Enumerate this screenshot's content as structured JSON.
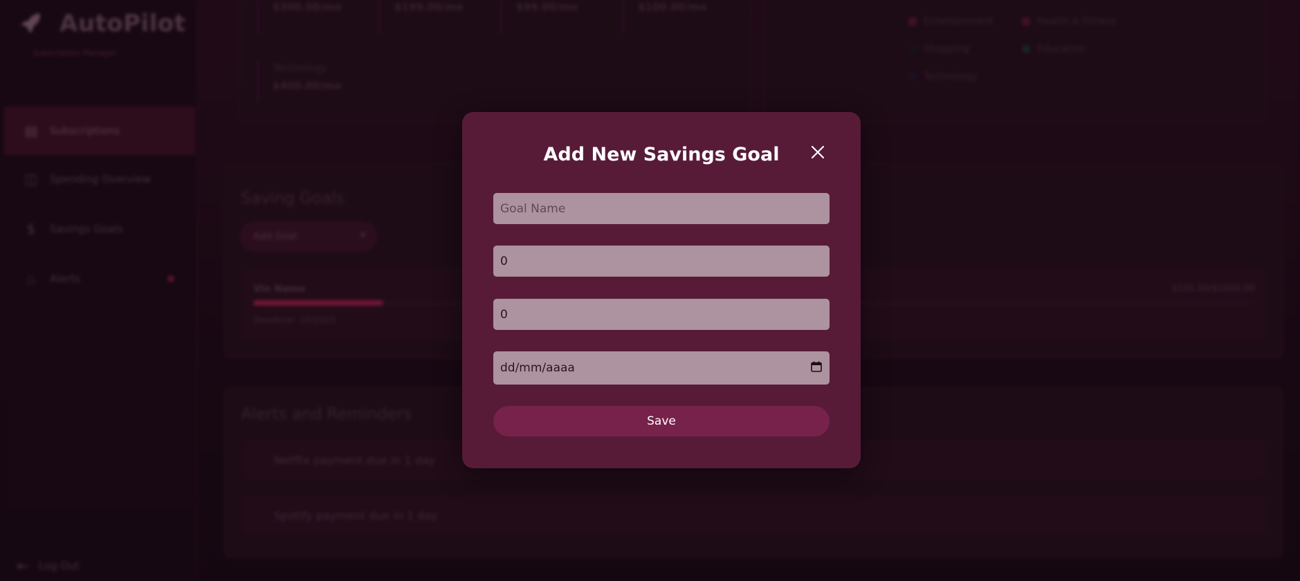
{
  "app": {
    "brand_name": "AutoPilot",
    "brand_tagline": "Subscription Manager",
    "brand_icon": "rocket-icon"
  },
  "sidebar": {
    "items": [
      {
        "label": "Subscriptions",
        "icon": "calendar-icon",
        "active": true
      },
      {
        "label": "Spending Overview",
        "icon": "chart-icon",
        "active": false
      },
      {
        "label": "Savings Goals",
        "icon": "dollar-icon",
        "active": false
      },
      {
        "label": "Alerts",
        "icon": "bell-icon",
        "active": false
      }
    ],
    "logout_label": "Log Out"
  },
  "subscriptions": {
    "cards": [
      {
        "amount": "$300.00/mo"
      },
      {
        "amount": "$199.00/mo"
      },
      {
        "amount": "$99.00/mo"
      },
      {
        "amount": "$100.00/mo"
      },
      {
        "category": "Technology",
        "amount": "$400.00/mo"
      }
    ],
    "legend": [
      {
        "label": "Entertainment",
        "color": "#5a1a30"
      },
      {
        "label": "Health & Fitness",
        "color": "#5a1a30"
      },
      {
        "label": "Shopping",
        "color": "#1a1a24"
      },
      {
        "label": "Education",
        "color": "#203030"
      },
      {
        "label": "Technology",
        "color": "#221a2c"
      }
    ]
  },
  "savings": {
    "title": "Saving Goals",
    "add_goal_label": "Add Goal",
    "goals": [
      {
        "name": "Vin Name",
        "amount": "$101.00/$1000.00",
        "progress": 0.13,
        "deadline": "Deadline: 10/2025"
      }
    ]
  },
  "alerts": {
    "title": "Alerts and Reminders",
    "items": [
      {
        "text": "Netflix payment due in 1 day"
      },
      {
        "text": "Spotify payment due in 1 day"
      }
    ]
  },
  "modal": {
    "title": "Add New Savings Goal",
    "close_icon": "close-icon",
    "goal_name_placeholder": "Goal Name",
    "target_value": "0",
    "current_value": "0",
    "date_placeholder": "dd/mm/aaaa",
    "date_icon": "calendar-icon",
    "save_label": "Save"
  },
  "colors": {
    "modal_bg": "#571b38",
    "input_bg": "#ad929f",
    "save_button": "#77224a"
  }
}
